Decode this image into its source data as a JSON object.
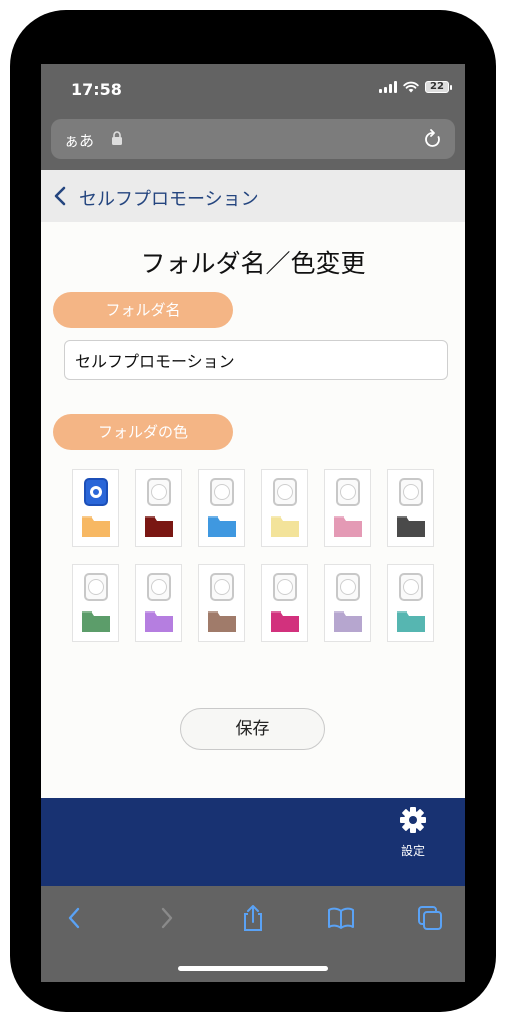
{
  "status_bar": {
    "time": "17:58",
    "battery": "22"
  },
  "url_bar": {
    "aa_label": "ぁあ"
  },
  "nav": {
    "back_title": "セルフプロモーション"
  },
  "page": {
    "title": "フォルダ名／色変更",
    "name_section_label": "フォルダ名",
    "name_value": "セルフプロモーション",
    "color_section_label": "フォルダの色",
    "save_label": "保存"
  },
  "colors": [
    {
      "name": "orange",
      "hex": "#f7b863",
      "selected": true
    },
    {
      "name": "dark-red",
      "hex": "#7a1713",
      "selected": false
    },
    {
      "name": "blue",
      "hex": "#3f98e0",
      "selected": false
    },
    {
      "name": "yellow",
      "hex": "#f3e39a",
      "selected": false
    },
    {
      "name": "pink",
      "hex": "#e49ab5",
      "selected": false
    },
    {
      "name": "dark-gray",
      "hex": "#4a4a4a",
      "selected": false
    },
    {
      "name": "green",
      "hex": "#5c9d6a",
      "selected": false
    },
    {
      "name": "purple",
      "hex": "#b57ee0",
      "selected": false
    },
    {
      "name": "brown",
      "hex": "#a07b6a",
      "selected": false
    },
    {
      "name": "magenta",
      "hex": "#d2317d",
      "selected": false
    },
    {
      "name": "lavender",
      "hex": "#b6a6cf",
      "selected": false
    },
    {
      "name": "teal",
      "hex": "#56b6b1",
      "selected": false
    }
  ],
  "footer": {
    "settings_label": "設定",
    "settings_icon": "gear-icon"
  },
  "toolbar": {
    "icons": [
      "back-arrow-icon",
      "forward-arrow-icon",
      "share-icon",
      "bookmarks-icon",
      "tabs-icon"
    ]
  },
  "theme": {
    "accent": "#f4b585",
    "footer": "#183272",
    "nav_text": "#24457f"
  }
}
